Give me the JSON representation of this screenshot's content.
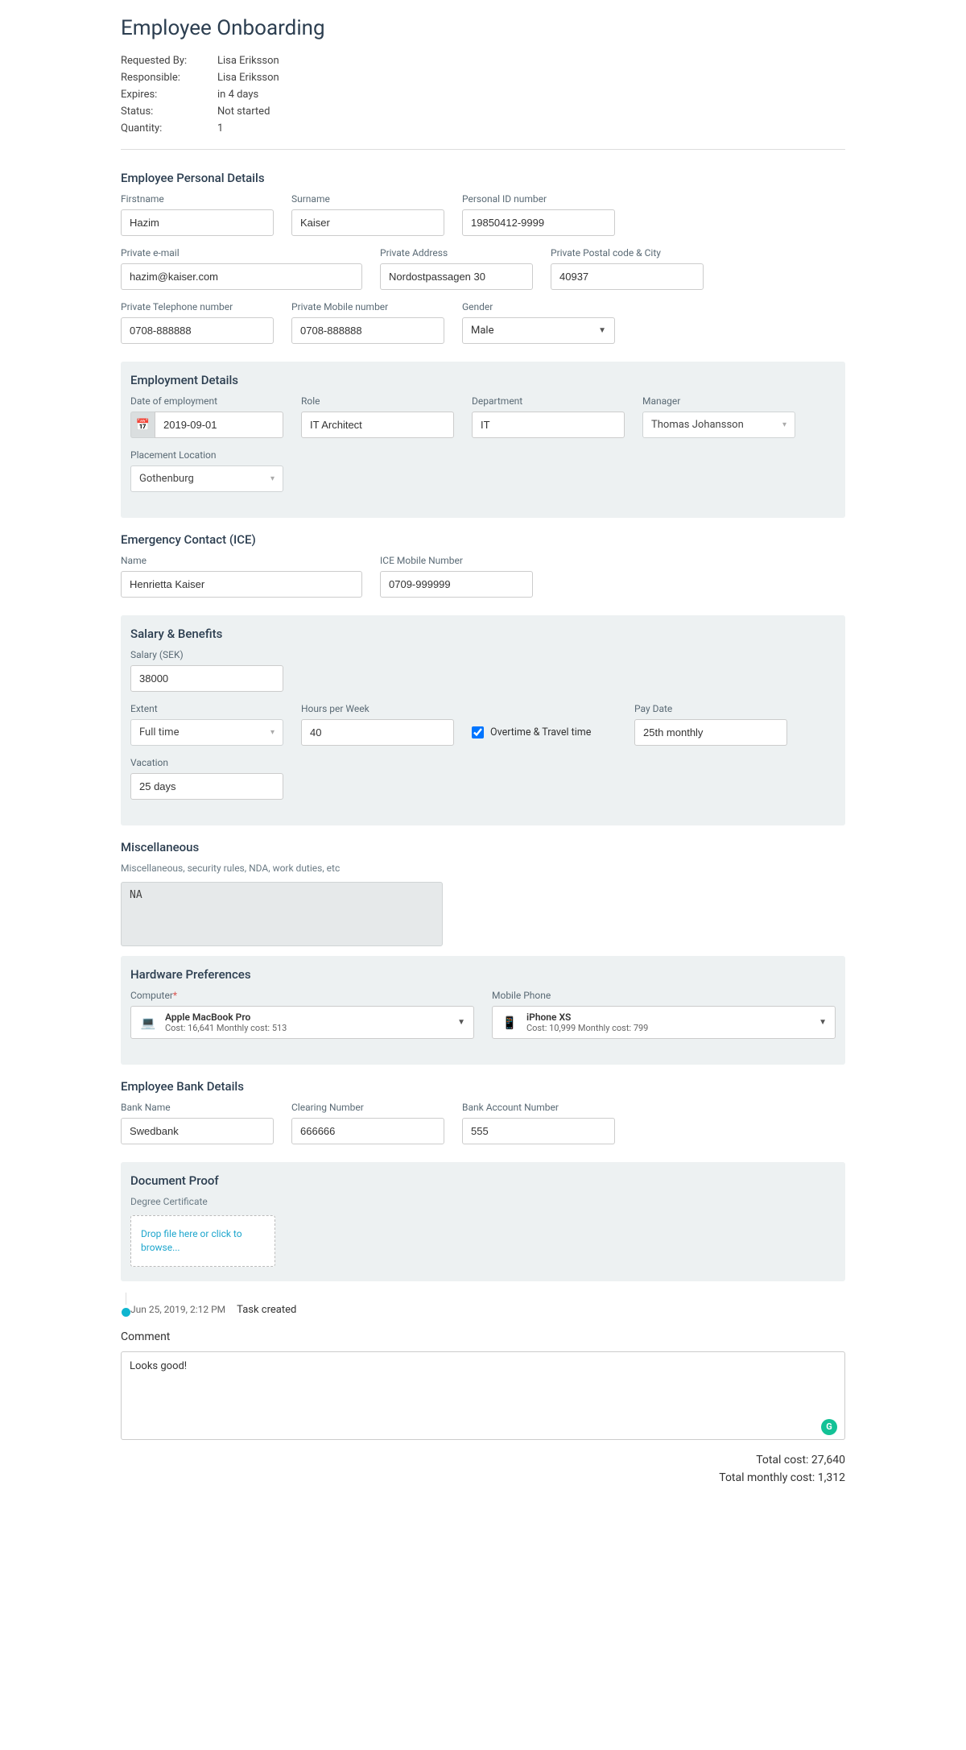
{
  "title": "Employee Onboarding",
  "meta": {
    "requested_by_label": "Requested By:",
    "requested_by": "Lisa Eriksson",
    "responsible_label": "Responsible:",
    "responsible": "Lisa Eriksson",
    "expires_label": "Expires:",
    "expires": "in 4 days",
    "status_label": "Status:",
    "status": "Not started",
    "quantity_label": "Quantity:",
    "quantity": "1"
  },
  "personal": {
    "section": "Employee Personal Details",
    "firstname_label": "Firstname",
    "firstname": "Hazim",
    "surname_label": "Surname",
    "surname": "Kaiser",
    "pid_label": "Personal ID number",
    "pid": "19850412-9999",
    "email_label": "Private e-mail",
    "email": "hazim@kaiser.com",
    "address_label": "Private Address",
    "address": "Nordostpassagen 30",
    "postal_label": "Private Postal code & City",
    "postal": "40937",
    "tel_label": "Private Telephone number",
    "tel": "0708-888888",
    "mob_label": "Private Mobile number",
    "mob": "0708-888888",
    "gender_label": "Gender",
    "gender": "Male"
  },
  "employment": {
    "section": "Employment Details",
    "date_label": "Date of employment",
    "date": "2019-09-01",
    "role_label": "Role",
    "role": "IT Architect",
    "dept_label": "Department",
    "dept": "IT",
    "manager_label": "Manager",
    "manager": "Thomas Johansson",
    "placement_label": "Placement Location",
    "placement": "Gothenburg"
  },
  "ice": {
    "section": "Emergency Contact (ICE)",
    "name_label": "Name",
    "name": "Henrietta Kaiser",
    "mob_label": "ICE Mobile Number",
    "mob": "0709-999999"
  },
  "salary": {
    "section": "Salary & Benefits",
    "salary_label": "Salary (SEK)",
    "salary": "38000",
    "extent_label": "Extent",
    "extent": "Full time",
    "hpw_label": "Hours per Week",
    "hpw": "40",
    "overtime_label": "Overtime & Travel time",
    "paydate_label": "Pay Date",
    "paydate": "25th monthly",
    "vacation_label": "Vacation",
    "vacation": "25 days"
  },
  "misc": {
    "section": "Miscellaneous",
    "sub": "Miscellaneous, security rules, NDA, work duties, etc",
    "value": "NA"
  },
  "hardware": {
    "section": "Hardware Preferences",
    "computer_label": "Computer",
    "computer_name": "Apple MacBook Pro",
    "computer_cost": "Cost: 16,641 Monthly cost: 513",
    "phone_label": "Mobile Phone",
    "phone_name": "iPhone XS",
    "phone_cost": "Cost: 10,999 Monthly cost: 799"
  },
  "bank": {
    "section": "Employee Bank Details",
    "name_label": "Bank Name",
    "name": "Swedbank",
    "clearing_label": "Clearing Number",
    "clearing": "666666",
    "account_label": "Bank Account Number",
    "account": "555"
  },
  "docs": {
    "section": "Document Proof",
    "sub": "Degree Certificate",
    "drop": "Drop file here or click to browse..."
  },
  "timeline": {
    "date": "Jun 25, 2019, 2:12 PM",
    "text": "Task created"
  },
  "comment": {
    "label": "Comment",
    "value": "Looks good!"
  },
  "totals": {
    "total": "Total cost: 27,640",
    "monthly": "Total monthly cost: 1,312"
  }
}
